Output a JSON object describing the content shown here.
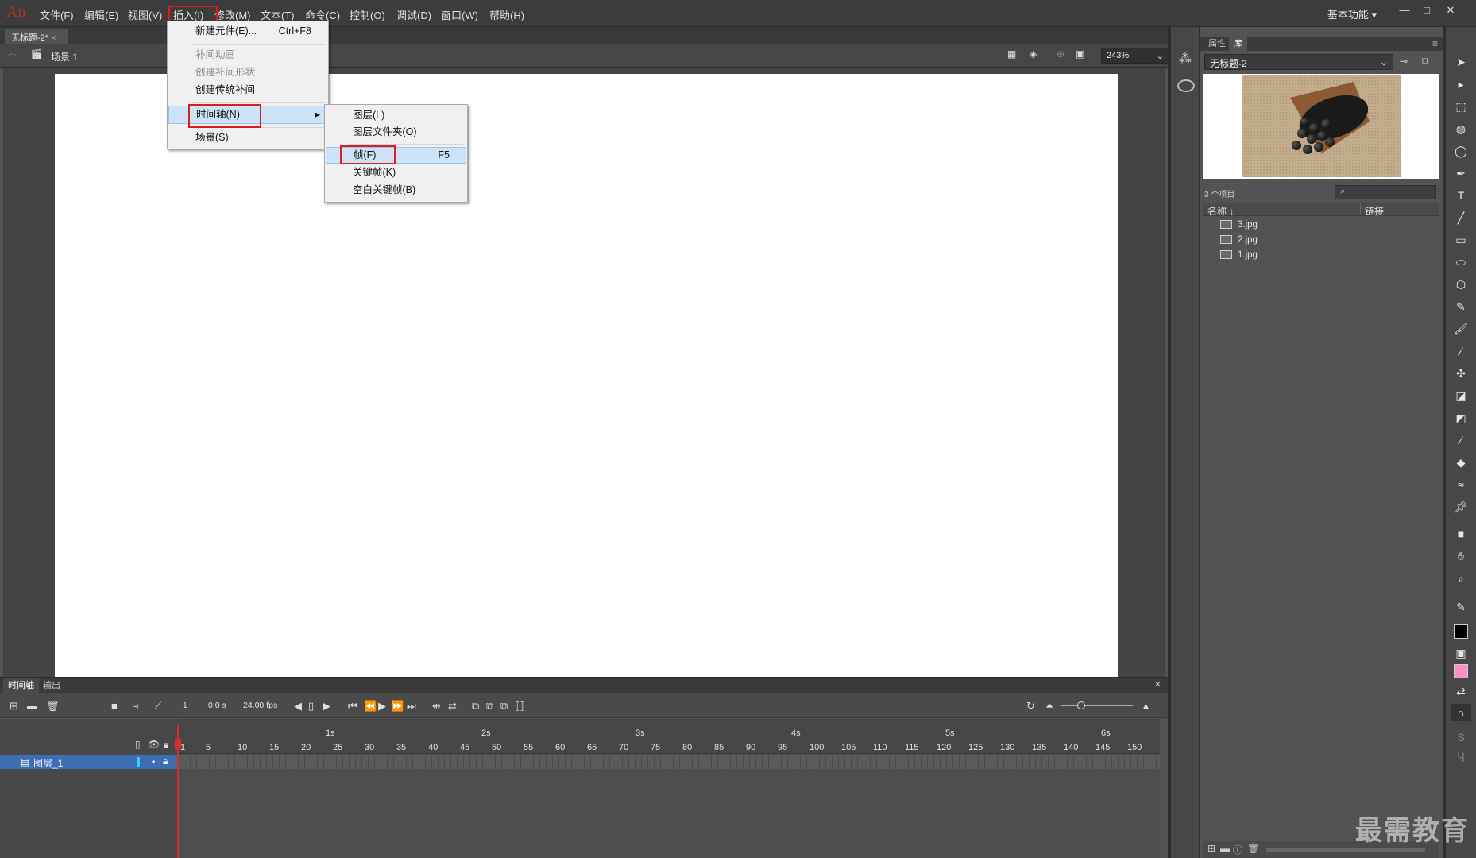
{
  "app": {
    "logo": "An"
  },
  "menubar": {
    "items": [
      "文件(F)",
      "编辑(E)",
      "视图(V)",
      "插入(I)",
      "修改(M)",
      "文本(T)",
      "命令(C)",
      "控制(O)",
      "调试(D)",
      "窗口(W)",
      "帮助(H)"
    ],
    "workspace": "基本功能"
  },
  "document": {
    "tab": "无标题-2*",
    "scene": "场景 1",
    "zoom": "243%"
  },
  "insert_menu": {
    "items": [
      {
        "label": "新建元件(E)...",
        "shortcut": "Ctrl+F8",
        "enabled": true
      },
      {
        "label": "补间动画",
        "enabled": false
      },
      {
        "label": "创建补间形状",
        "enabled": false
      },
      {
        "label": "创建传统补间",
        "enabled": true
      },
      {
        "label": "时间轴(N)",
        "submenu": true,
        "highlighted": true
      },
      {
        "label": "场景(S)",
        "enabled": true
      }
    ]
  },
  "timeline_submenu": {
    "items": [
      {
        "label": "图层(L)"
      },
      {
        "label": "图层文件夹(O)"
      },
      {
        "label": "帧(F)",
        "shortcut": "F5",
        "highlighted": true
      },
      {
        "label": "关键帧(K)"
      },
      {
        "label": "空白关键帧(B)"
      }
    ]
  },
  "library": {
    "tabs": [
      "属性",
      "库"
    ],
    "active_tab": "库",
    "document": "无标题-2",
    "count": "3 个项目",
    "col_name": "名称",
    "col_link": "链接",
    "items": [
      "3.jpg",
      "2.jpg",
      "1.jpg"
    ]
  },
  "timeline": {
    "tabs": [
      "时间轴",
      "输出"
    ],
    "frame": "1",
    "time": "0.0 s",
    "fps": "24.00 fps",
    "layer": "图层_1",
    "seconds": [
      "1s",
      "2s",
      "3s",
      "4s",
      "5s",
      "6s"
    ],
    "frame_numbers": [
      "1",
      "5",
      "10",
      "15",
      "20",
      "25",
      "30",
      "35",
      "40",
      "45",
      "50",
      "55",
      "60",
      "65",
      "70",
      "75",
      "80",
      "85",
      "90",
      "95",
      "100",
      "105",
      "110",
      "115",
      "120",
      "125",
      "130",
      "135",
      "140",
      "145",
      "150"
    ]
  },
  "watermark": "最需教育",
  "colors": {
    "accent_red": "#e01b1b",
    "stroke": "#000000",
    "fill": "#ff8fbf",
    "layer_selected": "#3d6db3"
  }
}
